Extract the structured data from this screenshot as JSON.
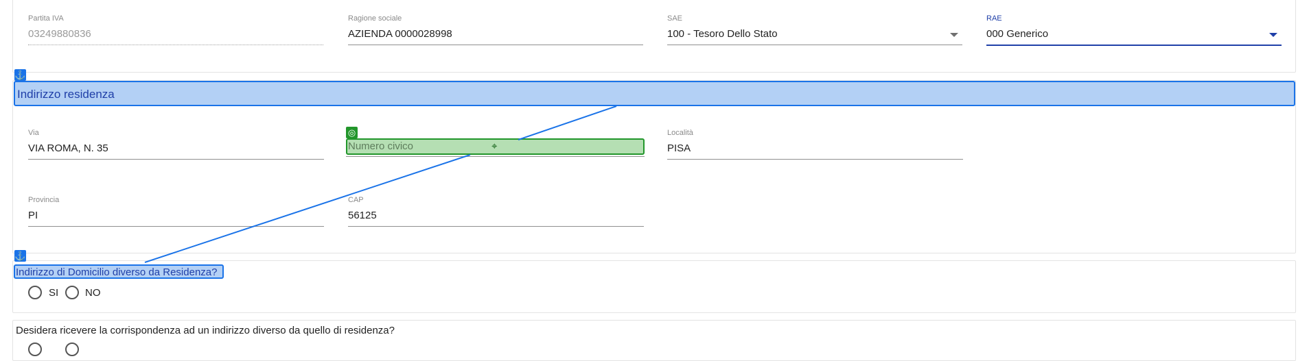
{
  "anagrafica": {
    "partita_iva": {
      "label": "Partita IVA",
      "value": "03249880836"
    },
    "ragione_sociale": {
      "label": "Ragione sociale",
      "value": "AZIENDA 0000028998"
    },
    "sae": {
      "label": "SAE",
      "value": "100 - Tesoro Dello Stato"
    },
    "rae": {
      "label": "RAE",
      "value": "000 Generico"
    }
  },
  "residenza": {
    "title": "Indirizzo residenza",
    "via": {
      "label": "Via",
      "value": "VIA ROMA, N. 35"
    },
    "numero_civico": {
      "placeholder": "Numero civico"
    },
    "localita": {
      "label": "Località",
      "value": "PISA"
    },
    "provincia": {
      "label": "Provincia",
      "value": "PI"
    },
    "cap": {
      "label": "CAP",
      "value": "56125"
    }
  },
  "domicilio": {
    "question": "Indirizzo di Domicilio diverso da Residenza?",
    "options": [
      "SI",
      "NO"
    ]
  },
  "corrispondenza": {
    "question": "Desidera ricevere la corrispondenza ad un indirizzo diverso da quello di residenza?"
  },
  "colors": {
    "anchor_blue": "#1a73e8",
    "highlight_blue": "#b3d0f5",
    "target_green": "#22962b",
    "target_fill": "#b5dfb3",
    "active_field": "#1f3fa8"
  },
  "icons": {
    "anchor": "anchor-icon",
    "target": "target-icon",
    "crosshair": "crosshair-icon",
    "dropdown": "chevron-down-icon"
  }
}
